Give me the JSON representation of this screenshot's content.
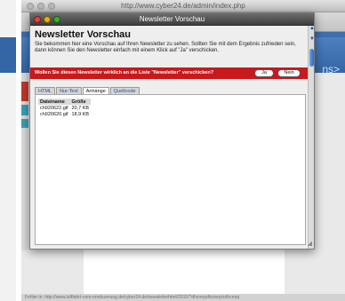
{
  "background": {
    "window_title": "http://www.cyber24.de/admin/index.php",
    "nav_text": "ns>",
    "status_text": "Fehler in: http://www.luftfahrt-vom-rendszerung.de/cyber24.de/newsletterhtml/2010/?dhcmrpdhcmrp/zdhcmrp"
  },
  "dialog": {
    "title": "Newsletter Vorschau",
    "heading": "Newsletter Vorschau",
    "intro": "Sie bekommen hier eine Vorschau auf Ihren Newsletter zu sehen. Sollten Sie mit dem Ergebnis zufrieden sein, dann können Sie den Newsletter einfach mit einem Klick auf \"Ja\" verschicken.",
    "confirm": {
      "text": "Wollen Sie diesen Newsletter wirklich an die Liste \"Newsletter\" verschicken?",
      "yes_label": "Ja",
      "no_label": "Nein"
    },
    "tabs": [
      {
        "label": "HTML",
        "active": false
      },
      {
        "label": "Nur-Text",
        "active": false
      },
      {
        "label": "Anhänge",
        "active": true
      },
      {
        "label": "Quellcode",
        "active": false
      }
    ],
    "files": {
      "headers": [
        "Dateiname",
        "Größe"
      ],
      "rows": [
        [
          "ch920622.gif",
          "20,7 KB"
        ],
        [
          "ch920620.gif",
          "18,9 KB"
        ]
      ]
    }
  },
  "colors": {
    "confirm_bar": "#c8191c",
    "nav_blue": "#3465a4",
    "tab_link": "#1f4e9c"
  }
}
